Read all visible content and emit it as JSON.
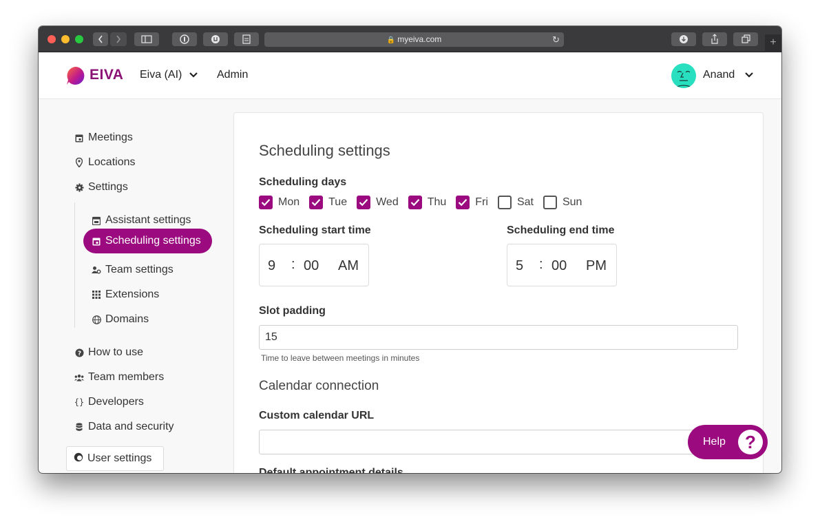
{
  "browser": {
    "url": "myeiva.com"
  },
  "header": {
    "brand": "EIVA",
    "org_menu": "Eiva (AI)",
    "admin_link": "Admin",
    "user_name": "Anand"
  },
  "sidebar": {
    "items": [
      {
        "label": "Meetings",
        "icon": "calendar-icon"
      },
      {
        "label": "Locations",
        "icon": "map-pin-icon"
      },
      {
        "label": "Settings",
        "icon": "gear-icon"
      }
    ],
    "sub_items": [
      {
        "label": "Assistant settings",
        "icon": "calendar-icon"
      },
      {
        "label": "Scheduling settings",
        "icon": "calendar-icon",
        "active": true
      },
      {
        "label": "Team settings",
        "icon": "users-cog-icon"
      },
      {
        "label": "Extensions",
        "icon": "grid-icon"
      },
      {
        "label": "Domains",
        "icon": "globe-icon"
      }
    ],
    "bottom_items": [
      {
        "label": "How to use",
        "icon": "question-circle-icon"
      },
      {
        "label": "Team members",
        "icon": "users-icon"
      },
      {
        "label": "Developers",
        "icon": "braces-icon"
      },
      {
        "label": "Data and security",
        "icon": "database-icon"
      }
    ],
    "user_settings": "User settings"
  },
  "main": {
    "title": "Scheduling settings",
    "scheduling_days_label": "Scheduling days",
    "days": [
      {
        "label": "Mon",
        "checked": true
      },
      {
        "label": "Tue",
        "checked": true
      },
      {
        "label": "Wed",
        "checked": true
      },
      {
        "label": "Thu",
        "checked": true
      },
      {
        "label": "Fri",
        "checked": true
      },
      {
        "label": "Sat",
        "checked": false
      },
      {
        "label": "Sun",
        "checked": false
      }
    ],
    "start_time_label": "Scheduling start time",
    "start_time": {
      "hour": "9",
      "sep": ":",
      "minute": "00",
      "ampm": "AM"
    },
    "end_time_label": "Scheduling end time",
    "end_time": {
      "hour": "5",
      "sep": ":",
      "minute": "00",
      "ampm": "PM"
    },
    "slot_padding_label": "Slot padding",
    "slot_padding_value": "15",
    "slot_padding_help": "Time to leave between meetings in minutes",
    "calendar_heading": "Calendar connection",
    "custom_calendar_label": "Custom calendar URL",
    "custom_calendar_value": "",
    "cut_off_label": "Default appointment details"
  },
  "help": {
    "label": "Help",
    "icon": "?"
  },
  "colors": {
    "accent": "#9b0a7f",
    "avatar": "#28e0c0"
  }
}
